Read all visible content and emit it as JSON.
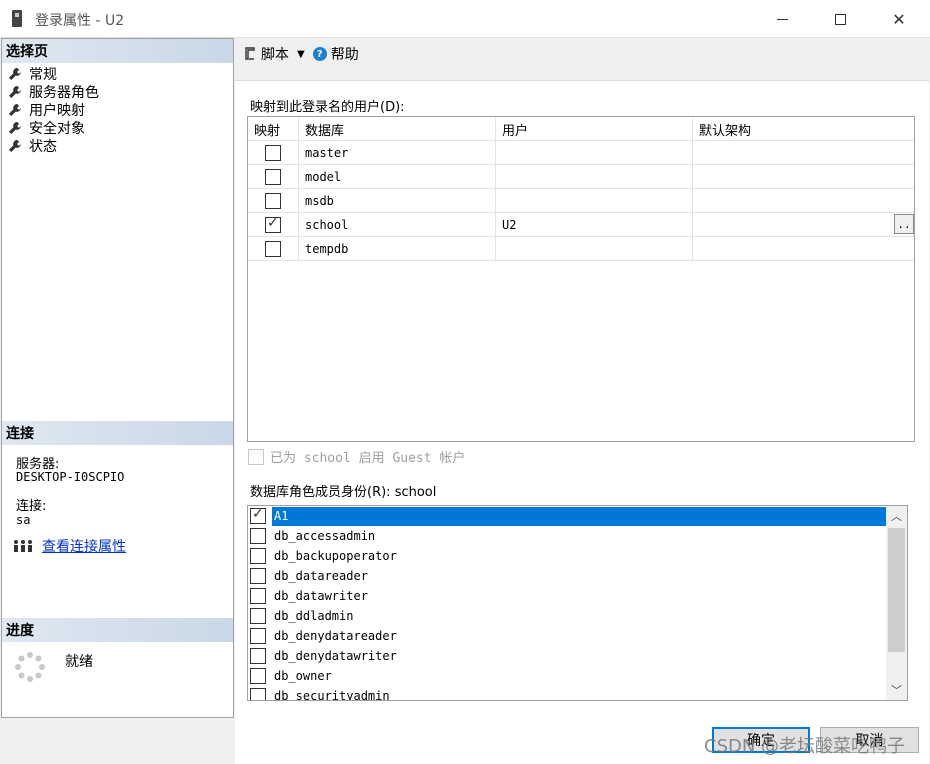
{
  "window": {
    "title": "登录属性 - U2"
  },
  "left": {
    "select_page_header": "选择页",
    "nav_items": [
      {
        "label": "常规"
      },
      {
        "label": "服务器角色"
      },
      {
        "label": "用户映射"
      },
      {
        "label": "安全对象"
      },
      {
        "label": "状态"
      }
    ],
    "connection_header": "连接",
    "server_label": "服务器:",
    "server_value": "DESKTOP-I0SCPIO",
    "connection_label": "连接:",
    "connection_value": "sa",
    "view_link": "查看连接属性",
    "progress_header": "进度",
    "progress_status": "就绪"
  },
  "toolbar": {
    "script_label": "脚本",
    "help_label": "帮助"
  },
  "mapping": {
    "label": "映射到此登录名的用户(D):",
    "columns": [
      "映射",
      "数据库",
      "用户",
      "默认架构"
    ],
    "rows": [
      {
        "mapped": false,
        "database": "master",
        "user": "",
        "schema": ""
      },
      {
        "mapped": false,
        "database": "model",
        "user": "",
        "schema": ""
      },
      {
        "mapped": false,
        "database": "msdb",
        "user": "",
        "schema": ""
      },
      {
        "mapped": true,
        "database": "school",
        "user": "U2",
        "schema": "",
        "ellipsis": ".."
      },
      {
        "mapped": false,
        "database": "tempdb",
        "user": "",
        "schema": ""
      }
    ]
  },
  "guest": {
    "label": "已为 school 启用 Guest 帐户"
  },
  "roles": {
    "label": "数据库角色成员身份(R): school",
    "items": [
      {
        "name": "A1",
        "checked": true,
        "selected": true
      },
      {
        "name": "db_accessadmin",
        "checked": false
      },
      {
        "name": "db_backupoperator",
        "checked": false
      },
      {
        "name": "db_datareader",
        "checked": false
      },
      {
        "name": "db_datawriter",
        "checked": false
      },
      {
        "name": "db_ddladmin",
        "checked": false
      },
      {
        "name": "db_denydatareader",
        "checked": false
      },
      {
        "name": "db_denydatawriter",
        "checked": false
      },
      {
        "name": "db_owner",
        "checked": false
      },
      {
        "name": "db_securityadmin",
        "checked": false
      }
    ]
  },
  "buttons": {
    "ok": "确定",
    "cancel": "取消"
  },
  "watermark": "CSDN @老坛酸菜吃鸭子",
  "colors": {
    "selection": "#0078d7",
    "section_header": "#c9d7e6",
    "link": "#0033cc"
  }
}
